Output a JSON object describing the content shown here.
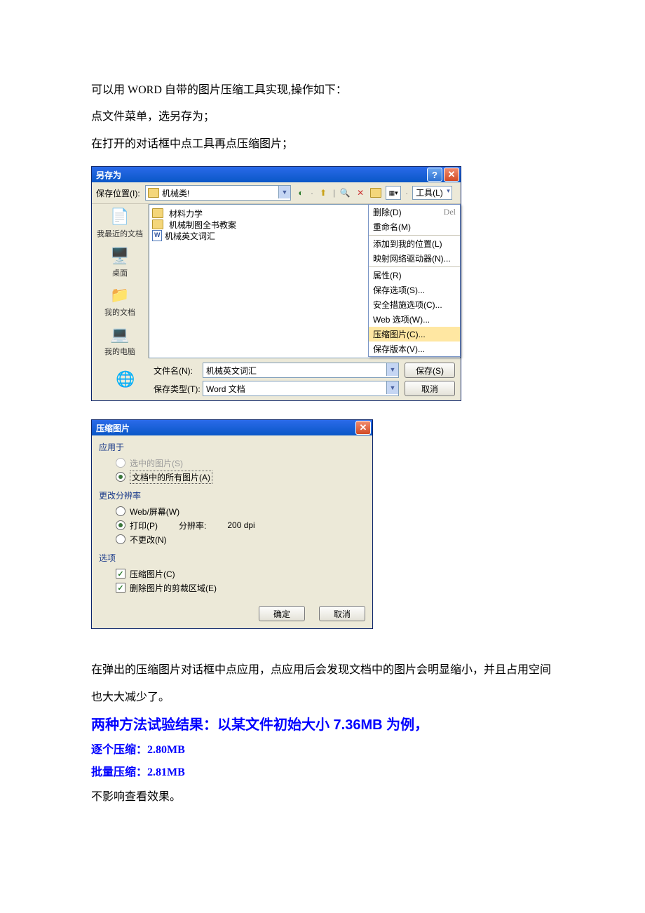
{
  "para": {
    "p1": "可以用 WORD 自带的图片压缩工具实现,操作如下：",
    "p2": "点文件菜单，选另存为；",
    "p3": "在打开的对话框中点工具再点压缩图片；",
    "p4": "在弹出的压缩图片对话框中点应用，点应用后会发现文档中的图片会明显缩小，并且占用空间也大大减少了。",
    "h2": "两种方法试验结果：以某文件初始大小 7.36MB 为例，",
    "r1": "逐个压缩：2.80MB",
    "r2": "批量压缩：2.81MB",
    "p5": "不影响查看效果。"
  },
  "saveas": {
    "title": "另存为",
    "loc_label": "保存位置(I):",
    "loc_value": "机械类!",
    "tools": "工具(L)",
    "places": {
      "recent": "我最近的文档",
      "desktop": "桌面",
      "mydocs": "我的文档",
      "mypc": "我的电脑"
    },
    "files": {
      "f1": "材料力学",
      "f2": "机械制图全书教案",
      "f3": "机械英文词汇"
    },
    "menu": {
      "del": "删除(D)",
      "del_k": "Del",
      "ren": "重命名(M)",
      "addloc": "添加到我的位置(L)",
      "mapnet": "映射网络驱动器(N)...",
      "prop": "属性(R)",
      "saveopt": "保存选项(S)...",
      "secopt": "安全措施选项(C)...",
      "webopt": "Web 选项(W)...",
      "compress": "压缩图片(C)...",
      "savever": "保存版本(V)..."
    },
    "name_label": "文件名(N):",
    "name_value": "机械英文词汇",
    "type_label": "保存类型(T):",
    "type_value": "Word 文档",
    "save_btn": "保存(S)",
    "cancel_btn": "取消"
  },
  "compress": {
    "title": "压缩图片",
    "g1": "应用于",
    "o1": "选中的图片(S)",
    "o2": "文档中的所有图片(A)",
    "g2": "更改分辨率",
    "o3": "Web/屏幕(W)",
    "o4": "打印(P)",
    "res_lbl": "分辨率:",
    "res_val": "200 dpi",
    "o5": "不更改(N)",
    "g3": "选项",
    "c1": "压缩图片(C)",
    "c2": "删除图片的剪裁区域(E)",
    "ok": "确定",
    "cancel": "取消"
  }
}
